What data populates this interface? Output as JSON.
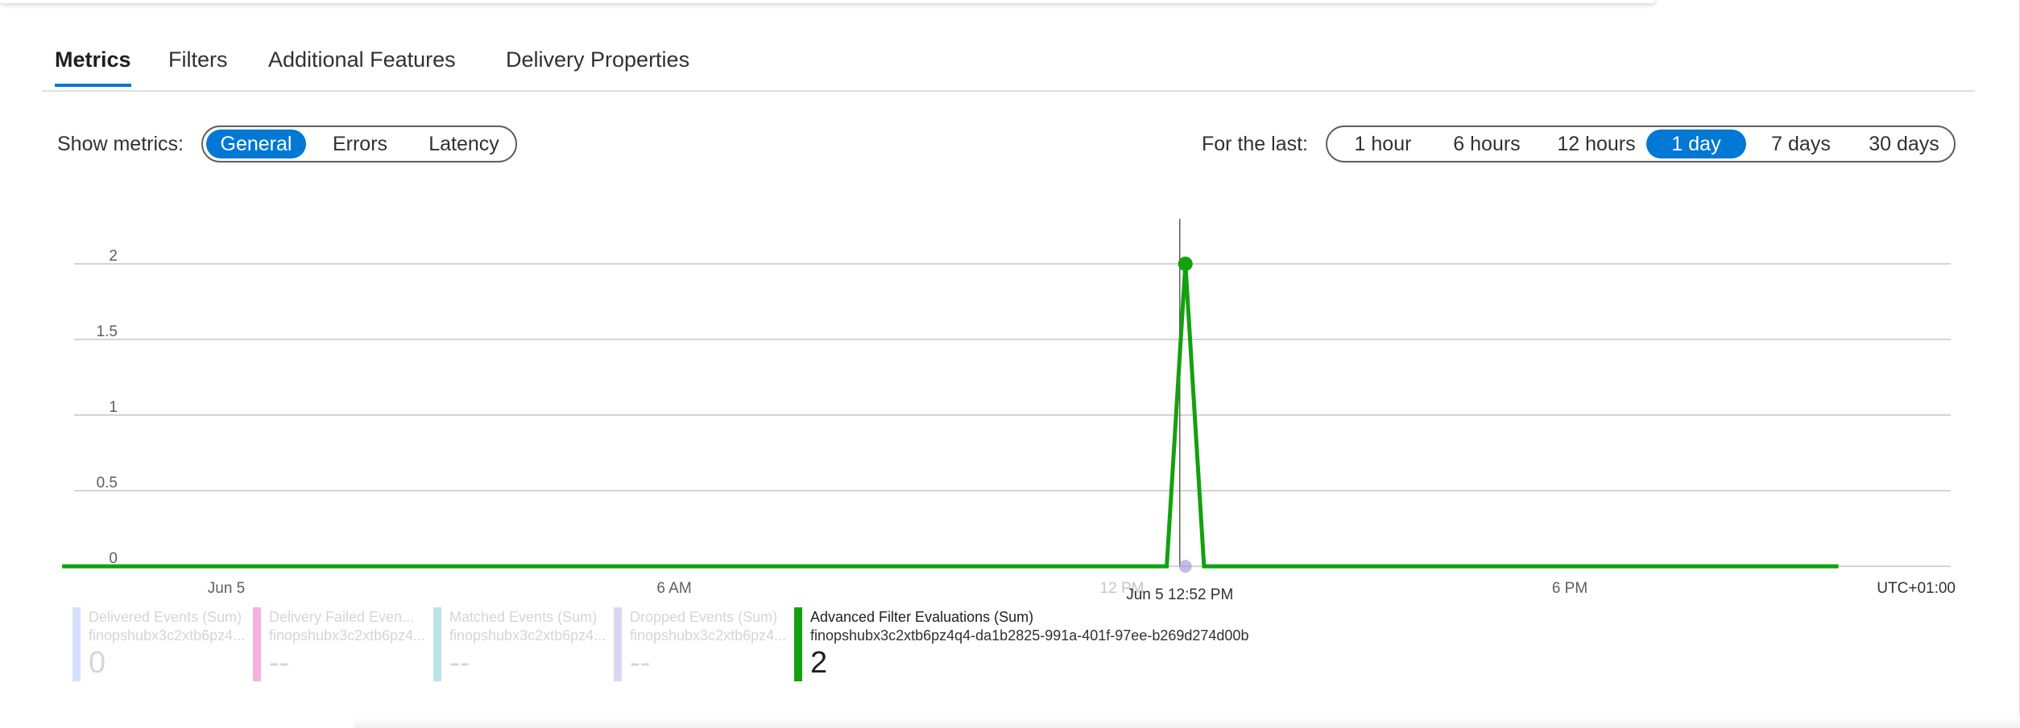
{
  "tabs": [
    {
      "label": "Metrics",
      "active": true
    },
    {
      "label": "Filters",
      "active": false
    },
    {
      "label": "Additional Features",
      "active": false
    },
    {
      "label": "Delivery Properties",
      "active": false
    }
  ],
  "show_metrics": {
    "label": "Show metrics:",
    "options": [
      {
        "label": "General",
        "active": true
      },
      {
        "label": "Errors",
        "active": false
      },
      {
        "label": "Latency",
        "active": false
      }
    ]
  },
  "time_range": {
    "label": "For the last:",
    "options": [
      {
        "label": "1 hour",
        "active": false
      },
      {
        "label": "6 hours",
        "active": false
      },
      {
        "label": "12 hours",
        "active": false
      },
      {
        "label": "1 day",
        "active": true
      },
      {
        "label": "7 days",
        "active": false
      },
      {
        "label": "30 days",
        "active": false
      }
    ]
  },
  "colors": {
    "accent": "#0078d4",
    "series_active": "#13a10e",
    "grid": "#c8c6c4"
  },
  "chart_data": {
    "type": "line",
    "ylim": [
      0,
      2
    ],
    "y_ticks": [
      "0",
      "0.5",
      "1",
      "1.5",
      "2"
    ],
    "x_ticks": [
      "Jun 5",
      "6 AM",
      "12 PM",
      "6 PM"
    ],
    "timezone_label": "UTC+01:00",
    "cursor_label": "Jun 5 12:52 PM",
    "grid": true,
    "x_range_hours": [
      -2.2,
      21.6
    ],
    "series": [
      {
        "name": "Advanced Filter Evaluations (Sum)",
        "color": "#13a10e",
        "points": [
          [
            -2.2,
            0
          ],
          [
            12.6,
            0
          ],
          [
            12.85,
            2
          ],
          [
            13.1,
            0
          ],
          [
            21.6,
            0
          ]
        ]
      }
    ],
    "cursor_hour": 12.85,
    "highlight_point": [
      12.85,
      2
    ]
  },
  "legend": [
    {
      "title": "Delivered Events (Sum)",
      "subtitle": "finopshubx3c2xtb6pz4...",
      "value": "0",
      "color": "#8ea6ff",
      "active": false
    },
    {
      "title": "Delivery Failed Even...",
      "subtitle": "finopshubx3c2xtb6pz4...",
      "value": "--",
      "color": "#e8239c",
      "active": false
    },
    {
      "title": "Matched Events (Sum)",
      "subtitle": "finopshubx3c2xtb6pz4...",
      "value": "--",
      "color": "#3fb4c0",
      "active": false
    },
    {
      "title": "Dropped Events (Sum)",
      "subtitle": "finopshubx3c2xtb6pz4...",
      "value": "--",
      "color": "#a08dd6",
      "active": false
    },
    {
      "title": "Advanced Filter Evaluations (Sum)",
      "subtitle": "finopshubx3c2xtb6pz4q4-da1b2825-991a-401f-97ee-b269d274d00b",
      "value": "2",
      "color": "#13a10e",
      "active": true
    }
  ]
}
